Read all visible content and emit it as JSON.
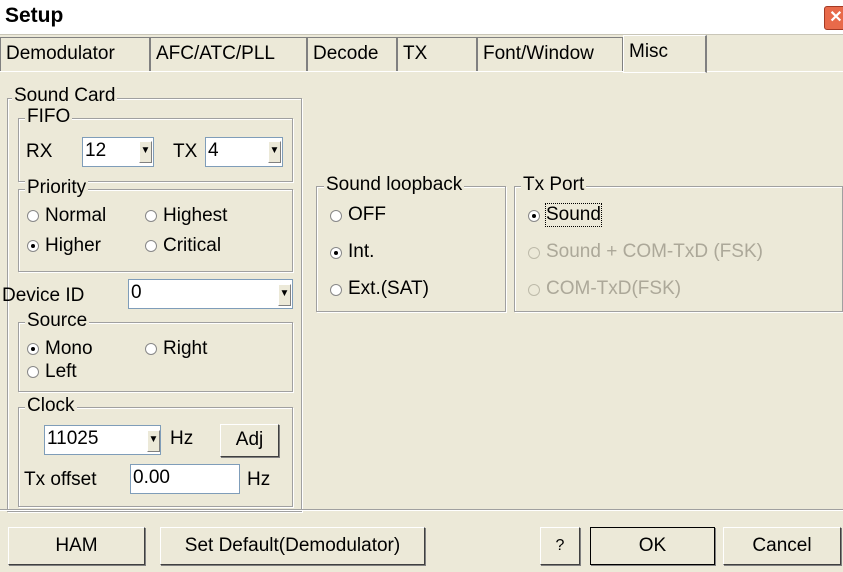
{
  "window": {
    "title": "Setup",
    "close_icon": "close-icon"
  },
  "tabs": [
    {
      "label": "Demodulator"
    },
    {
      "label": "AFC/ATC/PLL"
    },
    {
      "label": "Decode"
    },
    {
      "label": "TX"
    },
    {
      "label": "Font/Window"
    },
    {
      "label": "Misc",
      "active": true
    }
  ],
  "sound_card": {
    "title": "Sound Card",
    "fifo": {
      "title": "FIFO",
      "rx_label": "RX",
      "rx_value": "12",
      "tx_label": "TX",
      "tx_value": "4"
    },
    "priority": {
      "title": "Priority",
      "options": [
        "Normal",
        "Highest",
        "Higher",
        "Critical"
      ],
      "selected": "Higher"
    },
    "device_id": {
      "label": "Device ID",
      "value": "0"
    },
    "source": {
      "title": "Source",
      "options": [
        "Mono",
        "Right",
        "Left"
      ],
      "selected": "Mono"
    },
    "clock": {
      "title": "Clock",
      "value": "11025",
      "unit": "Hz",
      "adj_label": "Adj",
      "tx_offset_label": "Tx offset",
      "tx_offset_value": "0.00",
      "tx_offset_unit": "Hz"
    }
  },
  "loopback": {
    "title": "Sound loopback",
    "options": [
      "OFF",
      "Int.",
      "Ext.(SAT)"
    ],
    "selected": "Int."
  },
  "tx_port": {
    "title": "Tx Port",
    "options": [
      "Sound",
      "Sound + COM-TxD (FSK)",
      "COM-TxD(FSK)"
    ],
    "selected": "Sound"
  },
  "buttons": {
    "ham": "HAM",
    "set_default": "Set Default(Demodulator)",
    "help": "?",
    "ok": "OK",
    "cancel": "Cancel"
  }
}
